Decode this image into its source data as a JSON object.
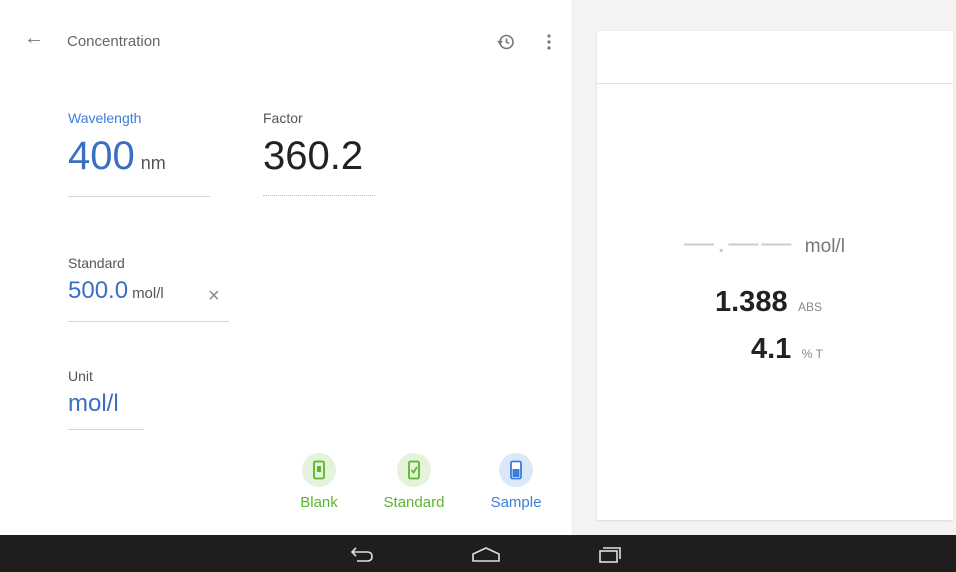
{
  "toolbar": {
    "title": "Concentration",
    "back_icon": "arrow-left-icon",
    "history_icon": "history-icon",
    "menu_icon": "more-vertical-icon"
  },
  "wavelength": {
    "label": "Wavelength",
    "value": "400",
    "unit": "nm"
  },
  "factor": {
    "label": "Factor",
    "value": "360.2"
  },
  "standard": {
    "label": "Standard",
    "value": "500.0",
    "unit": "mol/l",
    "clear": "×"
  },
  "unit_field": {
    "label": "Unit",
    "value": "mol/l"
  },
  "actions": [
    {
      "label": "Blank",
      "icon": "cuvette-blank-icon",
      "color": "#5bb52e"
    },
    {
      "label": "Standard",
      "icon": "cuvette-check-icon",
      "color": "#5bb52e"
    },
    {
      "label": "Sample",
      "icon": "cuvette-sample-icon",
      "color": "#3b7ddd"
    }
  ],
  "readings": {
    "concentration": {
      "value": "—.——",
      "unit": "mol/l"
    },
    "absorbance": {
      "value": "1.388",
      "unit": "ABS"
    },
    "transmittance": {
      "value": "4.1",
      "unit": "% T"
    }
  },
  "navbar": {
    "back_icon": "nav-back-icon",
    "home_icon": "nav-home-icon",
    "recents_icon": "nav-recents-icon"
  },
  "colors": {
    "accent": "#3b7ddd",
    "green": "#5bb52e",
    "navbar": "#1e1e1e"
  }
}
